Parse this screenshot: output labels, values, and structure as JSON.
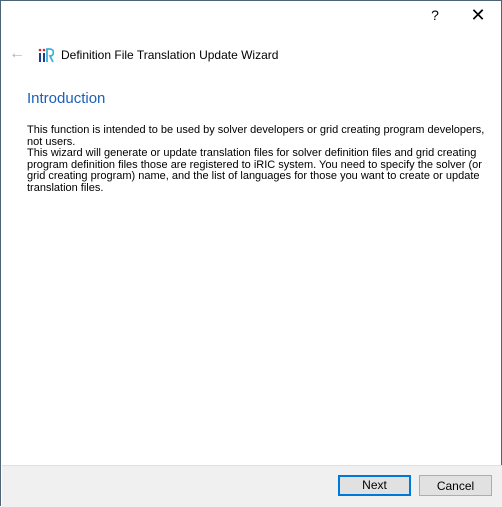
{
  "titlebar": {
    "help_label": "?",
    "close_label": "✕"
  },
  "header": {
    "back_icon": "arrow-left-icon",
    "logo": "iRIC",
    "title": "Definition File Translation Update Wizard"
  },
  "page": {
    "heading": "Introduction",
    "paragraphs": [
      "This function is intended to be used by solver developers or grid creating program developers, not users.",
      "This wizard will generate or update translation files for solver definition files and grid creating program definition files those are registered to iRIC system. You need to specify the solver (or grid creating program) name, and the list of languages for those you want to create or update translation files."
    ]
  },
  "footer": {
    "next_label": "Next",
    "cancel_label": "Cancel"
  },
  "colors": {
    "accent": "#0078d7",
    "heading": "#1c5fba"
  }
}
